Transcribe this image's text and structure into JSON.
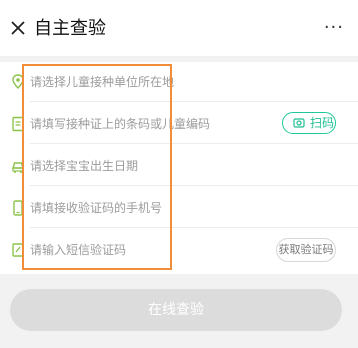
{
  "header": {
    "title": "自主查验",
    "more_label": "···"
  },
  "form": {
    "rows": [
      {
        "icon": "location-pin-icon",
        "placeholder": "请选择儿童接种单位所在地"
      },
      {
        "icon": "document-icon",
        "placeholder": "请填写接种证上的条码或儿童编码"
      },
      {
        "icon": "baby-car-icon",
        "placeholder": "请选择宝宝出生日期"
      },
      {
        "icon": "phone-icon",
        "placeholder": "请填接收验证码的手机号"
      },
      {
        "icon": "edit-icon",
        "placeholder": "请输入短信验证码"
      }
    ],
    "scan_button_label": "扫码",
    "get_code_button_label": "获取验证码"
  },
  "submit_button_label": "在线查验",
  "colors": {
    "accent": "#20c89a",
    "highlight": "#f08d3a",
    "placeholder": "#9c9c9c",
    "submit_disabled": "#dcdcdc"
  }
}
